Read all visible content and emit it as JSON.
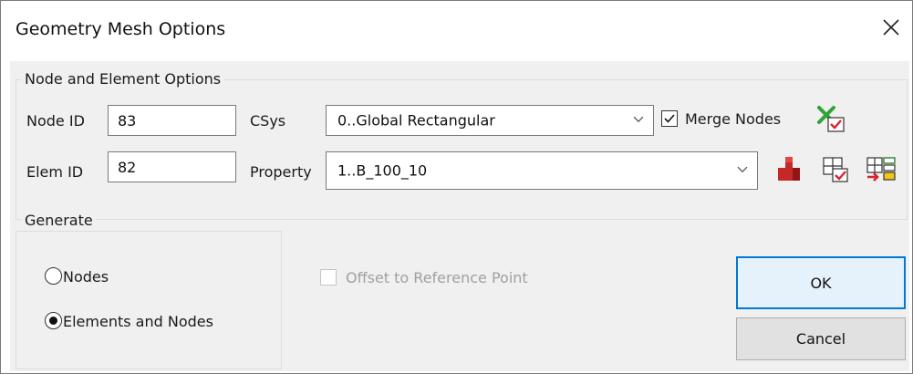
{
  "window": {
    "title": "Geometry Mesh Options",
    "close_label": "✕"
  },
  "node_element": {
    "group_label": "Node and Element Options",
    "node_id_label": "Node ID",
    "node_id_value": "83",
    "elem_id_label": "Elem ID",
    "elem_id_value": "82",
    "csys_label": "CSys",
    "csys_value": "0..Global Rectangular",
    "property_label": "Property",
    "property_value": "1..B_100_10",
    "merge_nodes_label": "Merge Nodes",
    "merge_nodes_checked": true
  },
  "generate": {
    "group_label": "Generate",
    "options": [
      {
        "label": "Nodes",
        "selected": false
      },
      {
        "label": "Elements and Nodes",
        "selected": true
      }
    ]
  },
  "offset": {
    "label": "Offset to Reference Point",
    "checked": false,
    "enabled": false
  },
  "buttons": {
    "ok": "OK",
    "cancel": "Cancel"
  },
  "icons": {
    "merge_options": "merge-tolerance-icon",
    "new_property": "solid-property-icon",
    "select_elements": "select-elements-icon",
    "element_options": "element-options-icon"
  }
}
